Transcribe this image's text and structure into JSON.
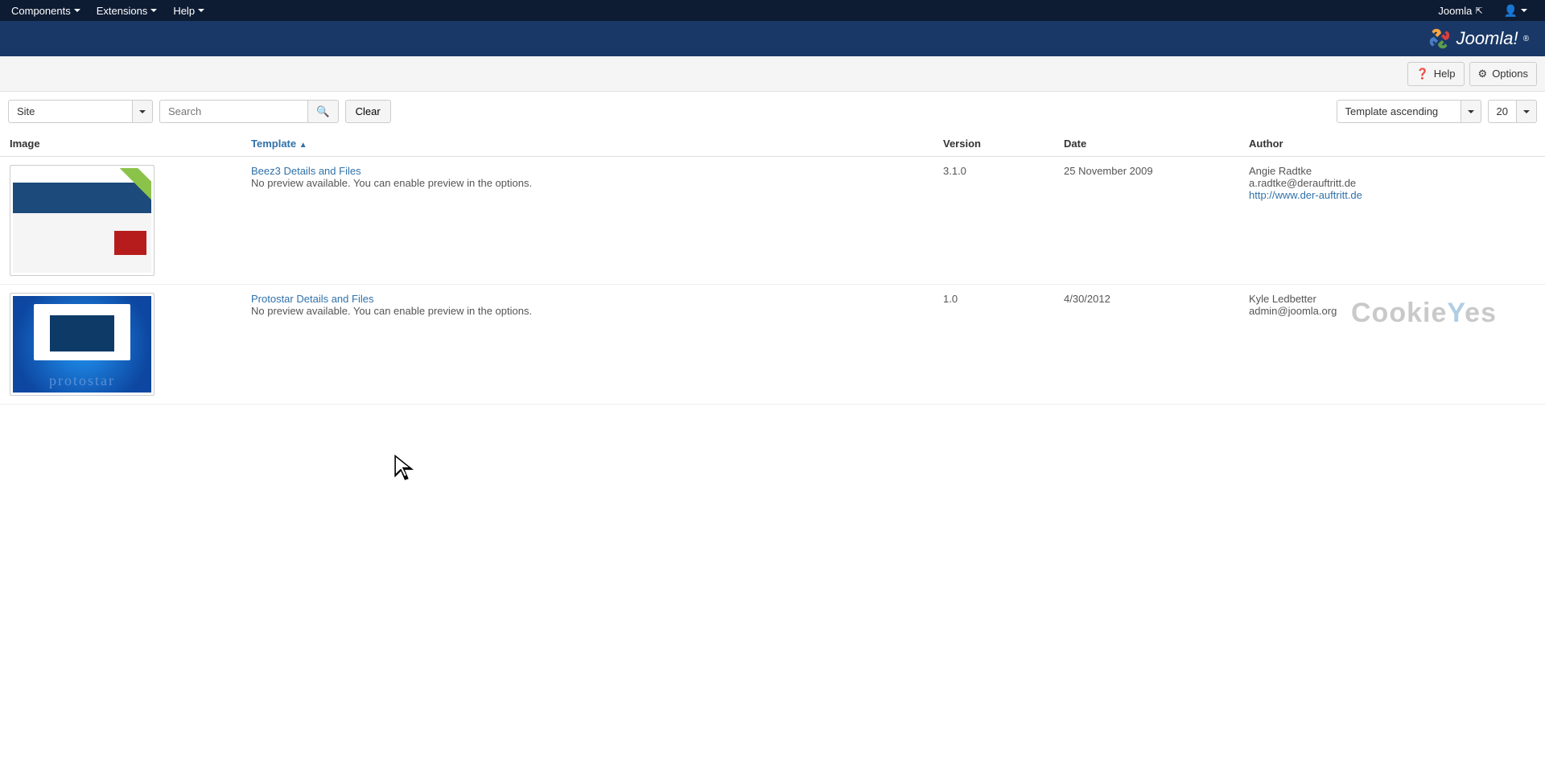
{
  "topnav": {
    "items": [
      "Components",
      "Extensions",
      "Help"
    ],
    "right_link": "Joomla"
  },
  "brand": "Joomla!",
  "toolbar": {
    "help": "Help",
    "options": "Options"
  },
  "filters": {
    "site_label": "Site",
    "search_placeholder": "Search",
    "clear": "Clear",
    "sort": "Template ascending",
    "limit": "20"
  },
  "columns": {
    "image": "Image",
    "template": "Template",
    "version": "Version",
    "date": "Date",
    "author": "Author"
  },
  "rows": [
    {
      "thumb": "beez",
      "title": "Beez3 Details and Files",
      "desc": "No preview available. You can enable preview in the options.",
      "version": "3.1.0",
      "date": "25 November 2009",
      "author_name": "Angie Radtke",
      "author_email": "a.radtke@derauftritt.de",
      "author_url": "http://www.der-auftritt.de"
    },
    {
      "thumb": "protostar",
      "title": "Protostar Details and Files",
      "desc": "No preview available. You can enable preview in the options.",
      "version": "1.0",
      "date": "4/30/2012",
      "author_name": "Kyle Ledbetter",
      "author_email": "admin@joomla.org",
      "author_url": ""
    }
  ],
  "watermark": "CookieYes",
  "proto_label": "protostar"
}
